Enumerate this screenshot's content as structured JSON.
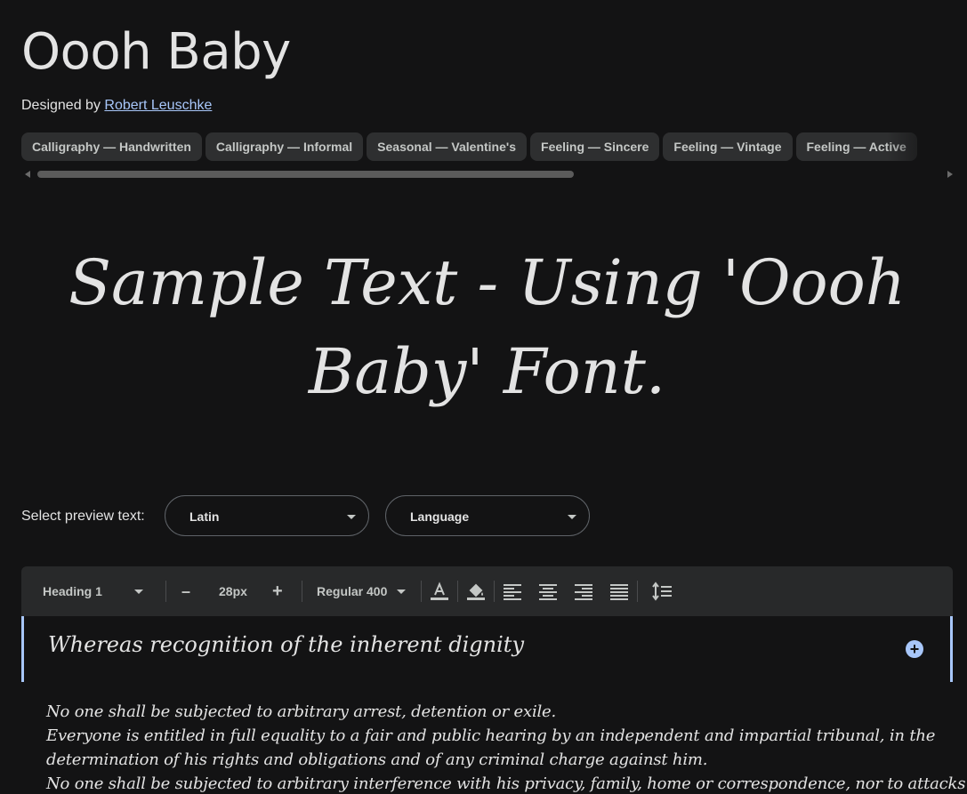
{
  "font": {
    "name": "Oooh Baby",
    "designed_by_label": "Designed by",
    "designer": "Robert Leuschke"
  },
  "tags": [
    "Calligraphy — Handwritten",
    "Calligraphy — Informal",
    "Seasonal — Valentine's",
    "Feeling — Sincere",
    "Feeling — Vintage",
    "Feeling — Active"
  ],
  "sample_text": "Sample Text - Using 'Oooh Baby' Font.",
  "preview": {
    "label": "Select preview text:",
    "script_value": "Latin",
    "language_value": "Language"
  },
  "toolbar": {
    "style": "Heading 1",
    "minus": "–",
    "size": "28px",
    "plus": "+",
    "weight": "Regular 400"
  },
  "editor": {
    "heading_text": "Whereas recognition of the inherent dignity",
    "add_label": "+"
  },
  "paragraphs": [
    "No one shall be subjected to arbitrary arrest, detention or exile.",
    "Everyone is entitled in full equality to a fair and public hearing by an independent and impartial tribunal, in the",
    "determination of his rights and obligations and of any criminal charge against him.",
    "No one shall be subjected to arbitrary interference with his privacy, family, home or correspondence, nor to attacks"
  ],
  "colors": {
    "background": "#131314",
    "accent": "#a8c7fa",
    "chip": "#2e2f30",
    "toolbar": "#28292a"
  }
}
